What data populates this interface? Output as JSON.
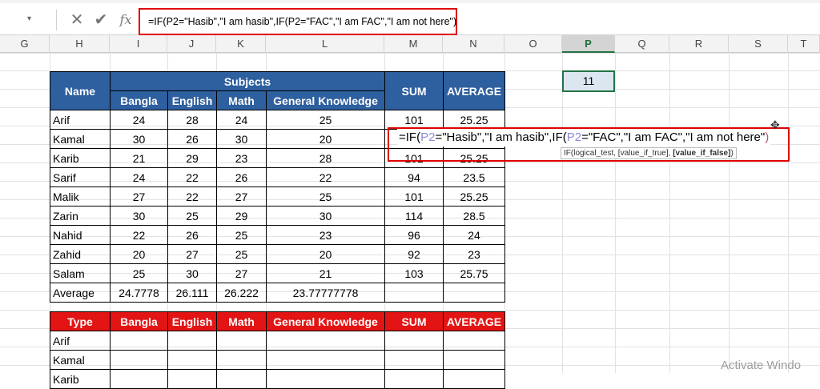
{
  "formula_bar": {
    "cancel_icon": "✕",
    "enter_icon": "✔",
    "fx_label": "fx",
    "formula": "=IF(P2=\"Hasib\",\"I am hasib\",IF(P2=\"FAC\",\"I am FAC\",\"I am not here\")"
  },
  "column_headers": [
    "G",
    "H",
    "I",
    "J",
    "K",
    "L",
    "M",
    "N",
    "O",
    "P",
    "Q",
    "R",
    "S",
    "T"
  ],
  "selected_column": "P",
  "p2_value": "11",
  "main_table": {
    "name_header": "Name",
    "subjects_header": "Subjects",
    "sum_header": "SUM",
    "average_header": "AVERAGE",
    "subject_columns": [
      "Bangla",
      "English",
      "Math",
      "General Knowledge"
    ],
    "rows": [
      {
        "name": "Arif",
        "bangla": "24",
        "english": "28",
        "math": "24",
        "gk": "25",
        "sum": "101",
        "avg": "25.25"
      },
      {
        "name": "Kamal",
        "bangla": "30",
        "english": "26",
        "math": "30",
        "gk": "20",
        "sum": "",
        "avg": ""
      },
      {
        "name": "Karib",
        "bangla": "21",
        "english": "29",
        "math": "23",
        "gk": "28",
        "sum": "101",
        "avg": "25.25"
      },
      {
        "name": "Sarif",
        "bangla": "24",
        "english": "22",
        "math": "26",
        "gk": "22",
        "sum": "94",
        "avg": "23.5"
      },
      {
        "name": "Malik",
        "bangla": "27",
        "english": "22",
        "math": "27",
        "gk": "25",
        "sum": "101",
        "avg": "25.25"
      },
      {
        "name": "Zarin",
        "bangla": "30",
        "english": "25",
        "math": "29",
        "gk": "30",
        "sum": "114",
        "avg": "28.5"
      },
      {
        "name": "Nahid",
        "bangla": "22",
        "english": "26",
        "math": "25",
        "gk": "23",
        "sum": "96",
        "avg": "24"
      },
      {
        "name": "Zahid",
        "bangla": "20",
        "english": "27",
        "math": "25",
        "gk": "20",
        "sum": "92",
        "avg": "23"
      },
      {
        "name": "Salam",
        "bangla": "25",
        "english": "30",
        "math": "27",
        "gk": "21",
        "sum": "103",
        "avg": "25.75"
      }
    ],
    "average_row": {
      "name": "Average",
      "bangla": "24.7778",
      "english": "26.111",
      "math": "26.222",
      "gk": "23.77777778"
    }
  },
  "cell_edit": {
    "part1": "=IF(",
    "ref1": "P2",
    "part2": "=\"Hasib\",\"I am hasib\",IF(",
    "ref2": "P2",
    "part3": "=\"FAC\",\"I am FAC\",\"I am not here\"",
    "close": ")"
  },
  "tooltip": {
    "text": "IF(logical_test, [value_if_true], ",
    "bold": "[value_if_false]",
    "close": ")"
  },
  "second_table": {
    "headers": [
      "Type",
      "Bangla",
      "English",
      "Math",
      "General Knowledge",
      "SUM",
      "AVERAGE"
    ],
    "rows": [
      "Arif",
      "Kamal",
      "Karib"
    ]
  },
  "watermark": "Activate Windo"
}
